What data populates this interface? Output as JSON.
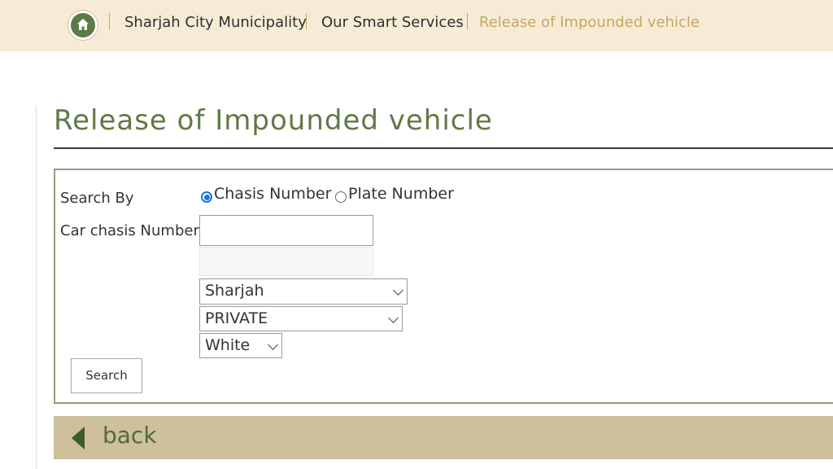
{
  "breadcrumb": {
    "home_icon": "home-icon",
    "items": [
      "Sharjah City Municipality",
      "Our Smart Services",
      "Release of Impounded vehicle"
    ]
  },
  "page": {
    "title": "Release of Impounded vehicle"
  },
  "form": {
    "search_by_label": "Search By",
    "radio_options": [
      {
        "label": "Chasis Number",
        "checked": true
      },
      {
        "label": "Plate Number",
        "checked": false
      }
    ],
    "chasis_label": "Car chasis Number",
    "chasis_value": "",
    "emirate_select": "Sharjah",
    "plate_type_select": "PRIVATE",
    "color_select": "White",
    "search_button": "Search"
  },
  "back": {
    "label": "back"
  },
  "colors": {
    "brand_green": "#5d7a46",
    "breadcrumb_bg": "#f6ecd6",
    "gold": "#c4a663",
    "back_bar": "#cec09a",
    "radio_blue": "#1a73e8"
  }
}
